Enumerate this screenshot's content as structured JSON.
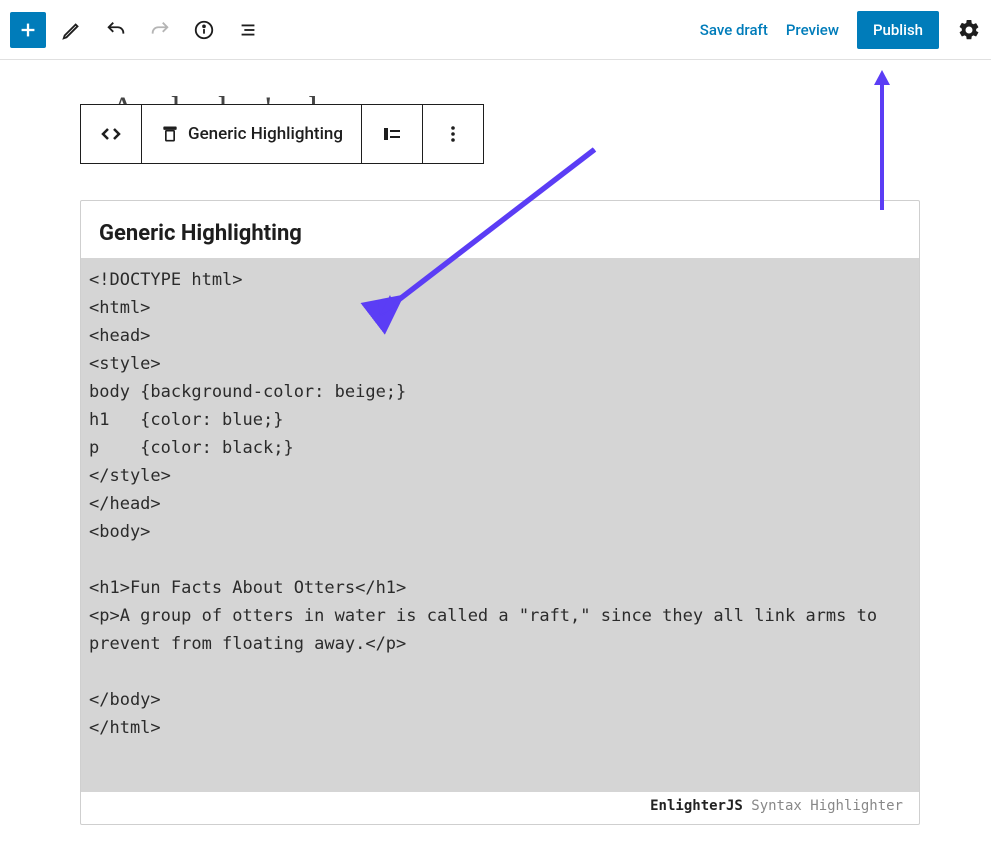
{
  "topbar": {
    "save_draft": "Save draft",
    "preview": "Preview",
    "publish": "Publish"
  },
  "title_fragment": "A  l  l    '    l",
  "toolbar": {
    "block_type_label": "Generic Highlighting"
  },
  "block": {
    "heading": "Generic Highlighting",
    "code": "<!DOCTYPE html>\n<html>\n<head>\n<style>\nbody {background-color: beige;}\nh1   {color: blue;}\np    {color: black;}\n</style>\n</head>\n<body>\n\n<h1>Fun Facts About Otters</h1>\n<p>A group of otters in water is called a \"raft,\" since they all link arms to prevent from floating away.</p>\n\n</body>\n</html>",
    "footer_strong": "EnlighterJS",
    "footer_rest": " Syntax Highlighter"
  },
  "colors": {
    "primary": "#007cba",
    "arrow": "#5b3df5"
  }
}
